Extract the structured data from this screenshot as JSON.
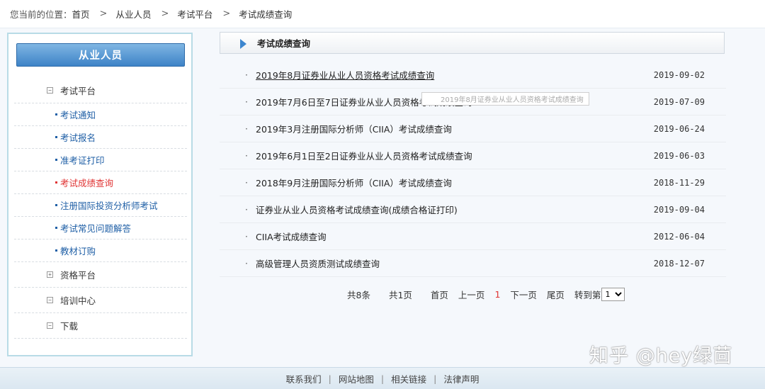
{
  "breadcrumb": {
    "prefix": "您当前的位置：",
    "items": [
      "首页",
      "从业人员",
      "考试平台",
      "考试成绩查询"
    ],
    "separator": ">"
  },
  "sidebar": {
    "header": "从业人员",
    "groups": [
      {
        "label": "考试平台",
        "toggle": "−"
      },
      {
        "label": "资格平台",
        "toggle": "+"
      },
      {
        "label": "培训中心",
        "toggle": "−"
      },
      {
        "label": "下载",
        "toggle": "−"
      }
    ],
    "sub_items": [
      {
        "label": "考试通知"
      },
      {
        "label": "考试报名"
      },
      {
        "label": "准考证打印"
      },
      {
        "label": "考试成绩查询",
        "active": true
      },
      {
        "label": "注册国际投资分析师考试"
      },
      {
        "label": "考试常见问题解答"
      },
      {
        "label": "教材订购"
      }
    ]
  },
  "main": {
    "title": "考试成绩查询",
    "bullet": "·",
    "rows": [
      {
        "title": "2019年8月证券业从业人员资格考试成绩查询",
        "date": "2019-09-02"
      },
      {
        "title": "2019年7月6日至7日证券业从业人员资格考试成绩查询",
        "date": "2019-07-09"
      },
      {
        "title": "2019年3月注册国际分析师（CIIA）考试成绩查询",
        "date": "2019-06-24"
      },
      {
        "title": "2019年6月1日至2日证券业从业人员资格考试成绩查询",
        "date": "2019-06-03"
      },
      {
        "title": "2018年9月注册国际分析师（CIIA）考试成绩查询",
        "date": "2018-11-29"
      },
      {
        "title": "证券业从业人员资格考试成绩查询(成绩合格证打印)",
        "date": "2019-09-04"
      },
      {
        "title": "CIIA考试成绩查询",
        "date": "2012-06-04"
      },
      {
        "title": "高级管理人员资质测试成绩查询",
        "date": "2018-12-07"
      }
    ],
    "tooltip": "2019年8月证券业从业人员资格考试成绩查询"
  },
  "pager": {
    "total_items": "共8条",
    "total_pages": "共1页",
    "first": "首页",
    "prev": "上一页",
    "current": "1",
    "next": "下一页",
    "last": "尾页",
    "goto": "转到第",
    "select_value": "1"
  },
  "footer": {
    "links": [
      "联系我们",
      "网站地图",
      "相关链接",
      "法律声明"
    ],
    "separator": "|"
  },
  "watermark": "知乎 @hey绿茴"
}
